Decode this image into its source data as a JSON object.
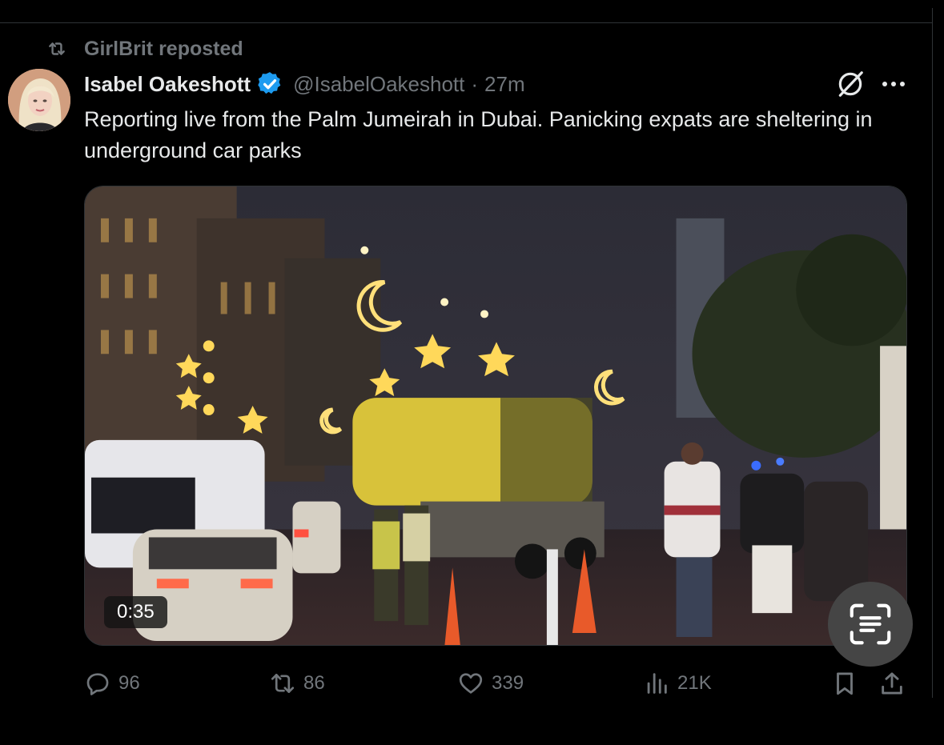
{
  "repost": {
    "label": "GirlBrit reposted",
    "icon": "repost-icon"
  },
  "author": {
    "display_name": "Isabel Oakeshott",
    "handle": "@IsabelOakeshott",
    "separator": "·",
    "time": "27m",
    "verified_color": "#1d9bf0"
  },
  "tweet": {
    "text": "Reporting live from the Palm Jumeirah in Dubai. Panicking expats are sheltering in underground car parks"
  },
  "media": {
    "duration": "0:35"
  },
  "stats": {
    "replies": "96",
    "reposts": "86",
    "likes": "339",
    "views": "21K"
  },
  "colors": {
    "background": "#000000",
    "text": "#e7e9ea",
    "muted": "#71767b",
    "accent": "#1d9bf0"
  },
  "icons": [
    "grok-icon",
    "more-icon",
    "reply-icon",
    "repost-icon",
    "like-icon",
    "views-icon",
    "bookmark-icon",
    "share-icon",
    "lens-scan-icon"
  ]
}
